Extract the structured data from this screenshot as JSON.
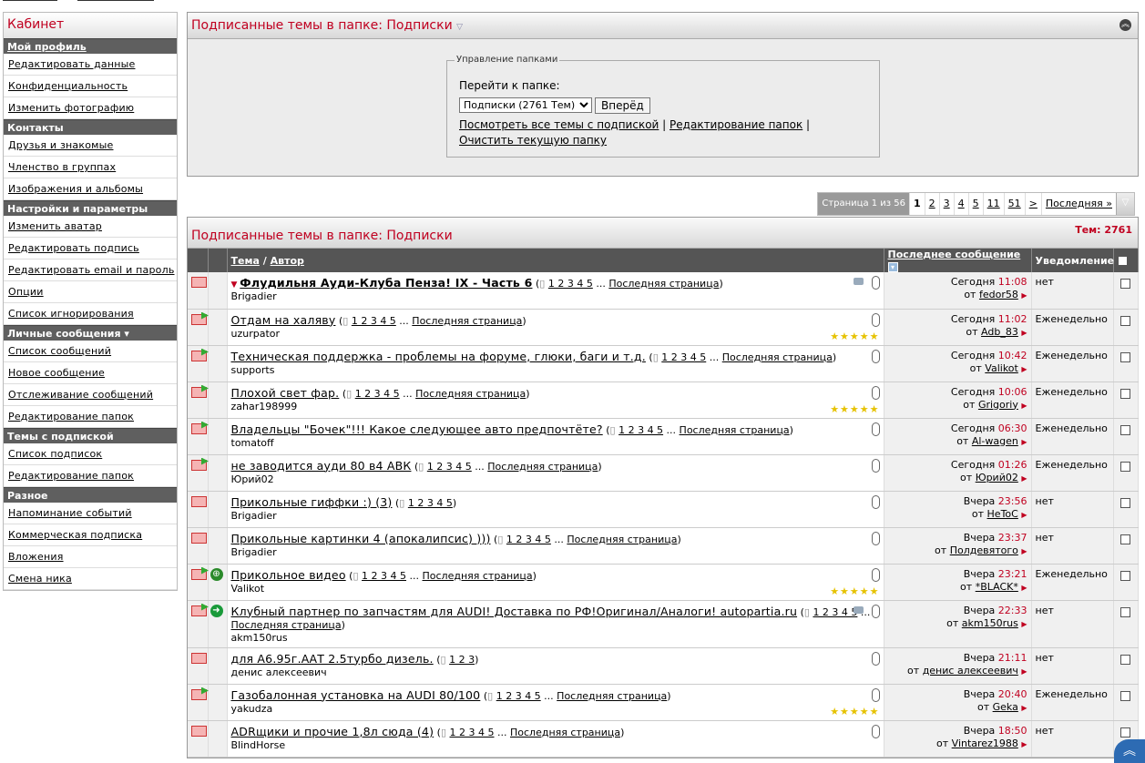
{
  "sidebar": {
    "title": "Кабинет",
    "sections": [
      {
        "heading": "Мой профиль",
        "underline": true,
        "items": [
          "Редактировать данные",
          "Конфиденциальность",
          "Изменить фотографию"
        ]
      },
      {
        "heading": "Контакты",
        "underline": false,
        "items": [
          "Друзья и знакомые",
          "Членство в группах",
          "Изображения и альбомы"
        ]
      },
      {
        "heading": "Настройки и параметры",
        "underline": false,
        "items": [
          "Изменить аватар",
          "Редактировать подпись",
          "Редактировать email и пароль",
          "Опции",
          "Список игнорирования"
        ]
      },
      {
        "heading": "Личные сообщения ▾",
        "underline": false,
        "items": [
          "Список сообщений",
          "Новое сообщение",
          "Отслеживание сообщений",
          "Редактирование папок"
        ]
      },
      {
        "heading": "Темы с подпиской",
        "underline": false,
        "items": [
          "Список подписок",
          "Редактирование папок"
        ]
      },
      {
        "heading": "Разное",
        "underline": false,
        "items": [
          "Напоминание событий",
          "Коммерческая подписка",
          "Вложения",
          "Смена ника"
        ]
      }
    ]
  },
  "top_panel": {
    "title": "Подписанные темы в папке:",
    "folder": "Подписки",
    "legend": "Управление папками",
    "goto_label": "Перейти к папке:",
    "select_value": "Подписки (2761 Тем)",
    "go_button": "Вперёд",
    "link_all": "Посмотреть все темы с подпиской",
    "link_edit": "Редактирование папок",
    "link_clear": "Очистить текущую папку",
    "sep": "|"
  },
  "pagination": {
    "info": "Страница 1 из 56",
    "pages": [
      "1",
      "2",
      "3",
      "4",
      "5",
      "11",
      "51",
      ">",
      "Последняя »"
    ],
    "current": "1"
  },
  "list": {
    "title": "Подписанные темы в папке:",
    "folder": "Подписки",
    "total": "Тем: 2761",
    "columns": {
      "topic": "Тема",
      "slash": "/",
      "author": "Автор",
      "last": "Последнее сообщение",
      "notify": "Уведомление"
    },
    "from_label": "от",
    "last_page": "Последняя страница",
    "rows": [
      {
        "title": "Флудильня Ауди-Клуба Пенза! IX - Часть 6",
        "bold": true,
        "pages": "1 2 3 4 5",
        "more": true,
        "author": "Brigadier",
        "day": "Сегодня",
        "time": "11:08",
        "by": "fedor58",
        "notify": "нет",
        "stars": false,
        "tag": true,
        "status": "",
        "new": false
      },
      {
        "title": "Отдам на халяву",
        "bold": false,
        "pages": "1 2 3 4 5",
        "more": true,
        "author": "uzurpator",
        "day": "Сегодня",
        "time": "11:02",
        "by": "Adb_83",
        "notify": "Еженедельно",
        "stars": true,
        "tag": false,
        "status": "",
        "new": true
      },
      {
        "title": "Техническая поддержка - проблемы на форуме, глюки, баги и т.д.",
        "bold": false,
        "pages": "1 2 3 4 5",
        "more": true,
        "author": "supports",
        "day": "Сегодня",
        "time": "10:42",
        "by": "Valikot",
        "notify": "Еженедельно",
        "stars": false,
        "tag": false,
        "status": "",
        "new": true
      },
      {
        "title": "Плохой свет фар.",
        "bold": false,
        "pages": "1 2 3 4 5",
        "more": true,
        "author": "zahar198999",
        "day": "Сегодня",
        "time": "10:06",
        "by": "Grigoriy",
        "notify": "Еженедельно",
        "stars": true,
        "tag": false,
        "status": "",
        "new": true
      },
      {
        "title": "Владельцы \"Бочек\"!!! Какое следующее авто предпочтёте?",
        "bold": false,
        "pages": "1 2 3 4 5",
        "more": true,
        "author": "tomatoff",
        "day": "Сегодня",
        "time": "06:30",
        "by": "Al-wagen",
        "notify": "Еженедельно",
        "stars": false,
        "tag": false,
        "status": "",
        "new": true
      },
      {
        "title": "не заводится ауди 80 в4 АВК",
        "bold": false,
        "pages": "1 2 3 4 5",
        "more": true,
        "author": "Юрий02",
        "day": "Сегодня",
        "time": "01:26",
        "by": "Юрий02",
        "notify": "Еженедельно",
        "stars": false,
        "tag": false,
        "status": "",
        "new": true
      },
      {
        "title": "Прикольные гиффки :) (3)",
        "bold": false,
        "pages": "1 2 3 4 5",
        "more": false,
        "author": "Brigadier",
        "day": "Вчера",
        "time": "23:56",
        "by": "HeToC",
        "notify": "нет",
        "stars": false,
        "tag": false,
        "status": "",
        "new": false
      },
      {
        "title": "Прикольные картинки 4 (апокалипсис) )))",
        "bold": false,
        "pages": "1 2 3 4 5",
        "more": true,
        "author": "Brigadier",
        "day": "Вчера",
        "time": "23:37",
        "by": "Полдевятого",
        "notify": "нет",
        "stars": false,
        "tag": false,
        "status": "",
        "new": false
      },
      {
        "title": "Прикольное видео",
        "bold": false,
        "pages": "1 2 3 4 5",
        "more": true,
        "author": "Valikot",
        "day": "Вчера",
        "time": "23:21",
        "by": "*BLACK*",
        "notify": "Еженедельно",
        "stars": true,
        "tag": false,
        "status": "globe",
        "new": true
      },
      {
        "title": "Клубный партнер по запчастям для AUDI! Доставка по РФ!Оригинал/Аналоги! autopartia.ru",
        "bold": false,
        "pages": "1 2 3 4 5",
        "more": true,
        "author": "akm150rus",
        "day": "Вчера",
        "time": "22:33",
        "by": "akm150rus",
        "notify": "нет",
        "stars": false,
        "tag": true,
        "status": "arrow",
        "new": true
      },
      {
        "title": "для А6.95г.ААТ 2.5турбо дизель.",
        "bold": false,
        "pages": "1 2 3",
        "more": false,
        "author": "денис алексеевич",
        "day": "Вчера",
        "time": "21:11",
        "by": "денис алексеевич",
        "notify": "нет",
        "stars": false,
        "tag": false,
        "status": "",
        "new": false
      },
      {
        "title": "Газобалонная установка на AUDI 80/100",
        "bold": false,
        "pages": "1 2 3 4 5",
        "more": true,
        "author": "yakudza",
        "day": "Вчера",
        "time": "20:40",
        "by": "Geka",
        "notify": "Еженедельно",
        "stars": true,
        "tag": false,
        "status": "",
        "new": true
      },
      {
        "title": "ADRщики и прочие 1,8л сюда (4)",
        "bold": false,
        "pages": "1 2 3 4 5",
        "more": true,
        "author": "BlindHorse",
        "day": "Вчера",
        "time": "18:50",
        "by": "Vintarez1988",
        "notify": "нет",
        "stars": false,
        "tag": false,
        "status": "",
        "new": false
      }
    ]
  },
  "icons": {
    "collapse": "collapse-up-icon",
    "attachment": "paperclip-icon",
    "rating": "stars-icon",
    "status_globe": "globe-icon",
    "status_arrow": "arrow-icon",
    "back_to_top": "scroll-top-icon"
  },
  "colors": {
    "accent": "#c00020",
    "section_bar": "#5f5f5f",
    "header_bar": "#555555"
  }
}
